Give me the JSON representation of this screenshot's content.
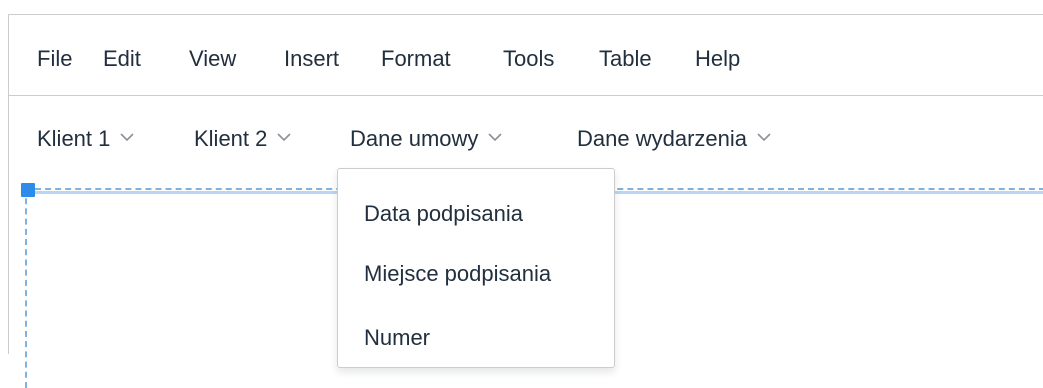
{
  "menubar": {
    "items": [
      "File",
      "Edit",
      "View",
      "Insert",
      "Format",
      "Tools",
      "Table",
      "Help"
    ]
  },
  "toolbar": {
    "items": [
      "Klient 1",
      "Klient 2",
      "Dane umowy",
      "Dane wydarzenia"
    ],
    "chevron_icon": "chevron-down-icon"
  },
  "dropdown": {
    "items": [
      "Data podpisania",
      "Miejsce podpisania",
      "Numer"
    ]
  },
  "colors": {
    "text": "#222f3e",
    "border": "#cccccc",
    "selection_handle": "#2d8ce9",
    "selection_outline": "#7fb2e0"
  }
}
